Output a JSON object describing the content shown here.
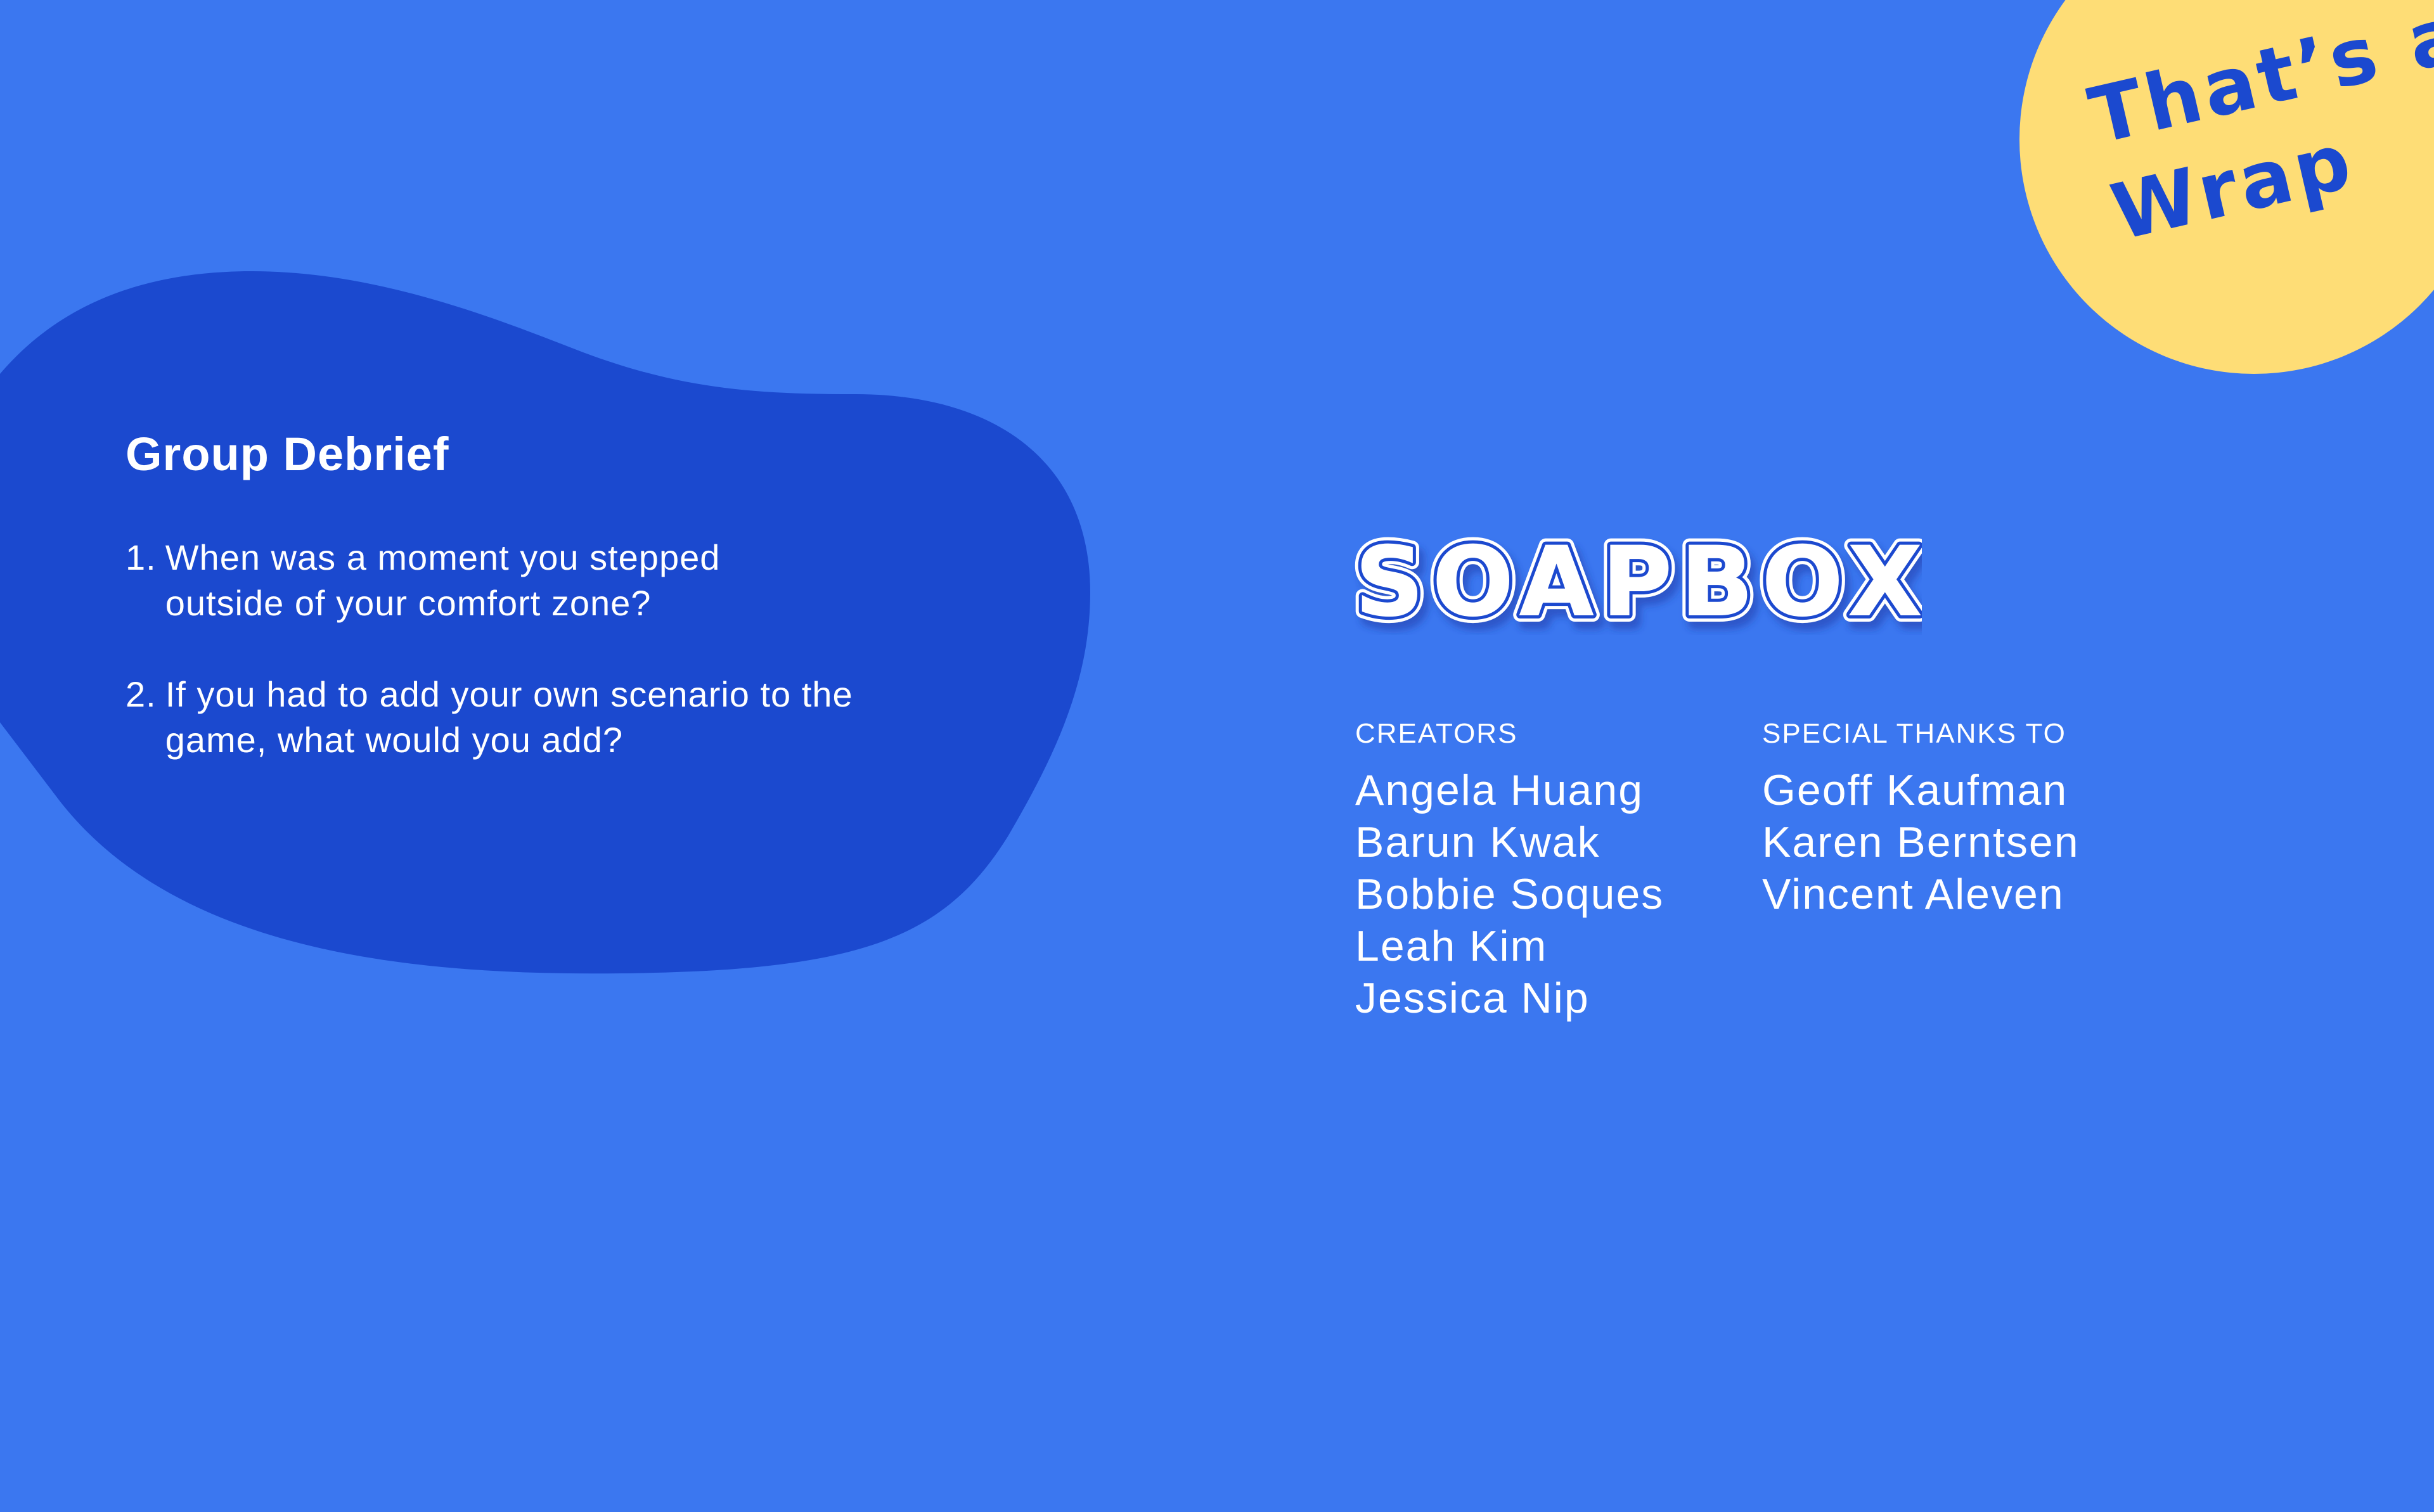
{
  "colors": {
    "background": "#3b77f0",
    "blob": "#1b49cf",
    "badge": "#fedd76",
    "badge_text": "#1b49cf",
    "text": "#ffffff"
  },
  "badge": {
    "line1": "That’s a",
    "line2": "Wrap"
  },
  "debrief": {
    "title": "Group Debrief",
    "questions": [
      {
        "num": "1.",
        "text": "When was a moment you stepped outside of your comfort zone?"
      },
      {
        "num": "2.",
        "text": "If you had to add your own scenario to the game, what would you add?"
      }
    ]
  },
  "logo": {
    "text": "SOAPBOX"
  },
  "credits": {
    "creators_heading": "CREATORS",
    "creators": [
      "Angela Huang",
      "Barun Kwak",
      "Bobbie Soques",
      "Leah Kim",
      "Jessica Nip"
    ],
    "thanks_heading": "SPECIAL THANKS TO",
    "thanks": [
      "Geoff Kaufman",
      "Karen Berntsen",
      "Vincent Aleven"
    ]
  }
}
